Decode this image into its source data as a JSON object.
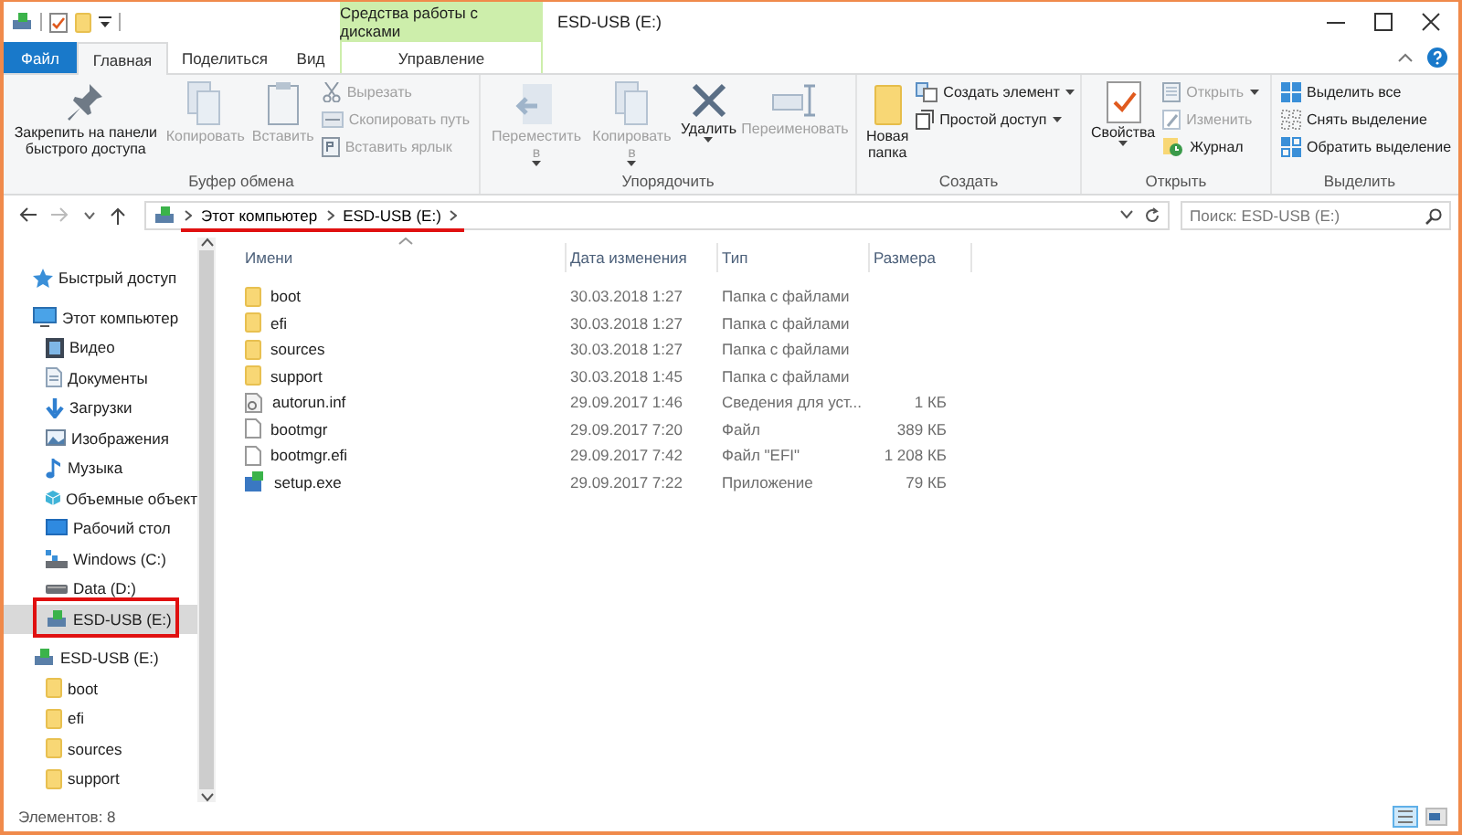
{
  "window": {
    "title": "ESD-USB (E:)",
    "context_tab": "Средства работы с дисками"
  },
  "ribbon_tabs": [
    {
      "label": "Файл",
      "kind": "file",
      "selected": false
    },
    {
      "label": "Главная",
      "kind": "tab",
      "selected": true
    },
    {
      "label": "Поделиться",
      "kind": "tab",
      "selected": false
    },
    {
      "label": "Вид",
      "kind": "tab",
      "selected": false
    },
    {
      "label": "Управление",
      "kind": "context",
      "selected": false
    }
  ],
  "ribbon_groups": [
    {
      "title": "Буфер обмена",
      "items": [
        {
          "label": "Закрепить на панели быстрого доступа",
          "kind": "big",
          "disabled": false,
          "dropdown": false
        },
        {
          "label": "Копировать",
          "kind": "big",
          "disabled": true,
          "dropdown": false
        },
        {
          "label": "Вставить",
          "kind": "big",
          "disabled": true,
          "dropdown": false
        },
        {
          "label": "Вырезать",
          "kind": "small",
          "disabled": true,
          "dropdown": false
        },
        {
          "label": "Скопировать путь",
          "kind": "small",
          "disabled": true,
          "dropdown": false
        },
        {
          "label": "Вставить ярлык",
          "kind": "small",
          "disabled": true,
          "dropdown": false
        }
      ]
    },
    {
      "title": "Упорядочить",
      "items": [
        {
          "label": "Переместить в",
          "kind": "big",
          "disabled": true,
          "dropdown": true
        },
        {
          "label": "Копировать в",
          "kind": "big",
          "disabled": true,
          "dropdown": true
        },
        {
          "label": "Удалить",
          "kind": "big",
          "disabled": false,
          "dropdown": true
        },
        {
          "label": "Переименовать",
          "kind": "big",
          "disabled": true,
          "dropdown": false
        }
      ]
    },
    {
      "title": "Создать",
      "items": [
        {
          "label": "Новая папка",
          "kind": "big",
          "disabled": false,
          "dropdown": false
        },
        {
          "label": "Создать элемент",
          "kind": "small",
          "disabled": false,
          "dropdown": true
        },
        {
          "label": "Простой доступ",
          "kind": "small",
          "disabled": false,
          "dropdown": true
        }
      ]
    },
    {
      "title": "Открыть",
      "items": [
        {
          "label": "Свойства",
          "kind": "big",
          "disabled": false,
          "dropdown": true
        },
        {
          "label": "Открыть",
          "kind": "small",
          "disabled": true,
          "dropdown": true
        },
        {
          "label": "Изменить",
          "kind": "small",
          "disabled": true,
          "dropdown": false
        },
        {
          "label": "Журнал",
          "kind": "small",
          "disabled": false,
          "dropdown": false
        }
      ]
    },
    {
      "title": "Выделить",
      "items": [
        {
          "label": "Выделить все",
          "kind": "small",
          "disabled": false,
          "dropdown": false
        },
        {
          "label": "Снять выделение",
          "kind": "small",
          "disabled": false,
          "dropdown": false
        },
        {
          "label": "Обратить выделение",
          "kind": "small",
          "disabled": false,
          "dropdown": false
        }
      ]
    }
  ],
  "address": {
    "path": [
      "Этот компьютер",
      "ESD-USB (E:)"
    ],
    "underlined": true
  },
  "search": {
    "placeholder": "Поиск: ESD-USB (E:)"
  },
  "nav": [
    {
      "label": "Быстрый доступ",
      "kind": "star",
      "selected": false,
      "highlighted": false
    },
    {
      "label": "Этот компьютер",
      "kind": "pc",
      "selected": false,
      "highlighted": false,
      "children": [
        {
          "label": "Видео",
          "kind": "video",
          "selected": false,
          "highlighted": false
        },
        {
          "label": "Документы",
          "kind": "docs",
          "selected": false,
          "highlighted": false
        },
        {
          "label": "Загрузки",
          "kind": "downloads",
          "selected": false,
          "highlighted": false
        },
        {
          "label": "Изображения",
          "kind": "pictures",
          "selected": false,
          "highlighted": false
        },
        {
          "label": "Музыка",
          "kind": "music",
          "selected": false,
          "highlighted": false
        },
        {
          "label": "Объемные объект",
          "kind": "cube",
          "selected": false,
          "highlighted": false
        },
        {
          "label": "Рабочий стол",
          "kind": "desktop",
          "selected": false,
          "highlighted": false
        },
        {
          "label": "Windows (C:)",
          "kind": "sysdrive",
          "selected": false,
          "highlighted": false
        },
        {
          "label": "Data (D:)",
          "kind": "drive",
          "selected": false,
          "highlighted": false
        },
        {
          "label": "ESD-USB (E:)",
          "kind": "usb",
          "selected": true,
          "highlighted": true
        }
      ]
    },
    {
      "label": "ESD-USB (E:)",
      "kind": "usb",
      "selected": false,
      "highlighted": false,
      "children": [
        {
          "label": "boot",
          "kind": "folder",
          "selected": false,
          "highlighted": false
        },
        {
          "label": "efi",
          "kind": "folder",
          "selected": false,
          "highlighted": false
        },
        {
          "label": "sources",
          "kind": "folder",
          "selected": false,
          "highlighted": false
        },
        {
          "label": "support",
          "kind": "folder",
          "selected": false,
          "highlighted": false
        }
      ]
    }
  ],
  "table": {
    "columns": [
      "Имени",
      "Дата изменения",
      "Тип",
      "Размера"
    ],
    "rows": [
      {
        "kind": "folder",
        "cells": [
          "boot",
          "30.03.2018 1:27",
          "Папка с файлами"
        ]
      },
      {
        "kind": "folder",
        "cells": [
          "efi",
          "30.03.2018 1:27",
          "Папка с файлами"
        ]
      },
      {
        "kind": "folder",
        "cells": [
          "sources",
          "30.03.2018 1:27",
          "Папка с файлами"
        ]
      },
      {
        "kind": "folder",
        "cells": [
          "support",
          "30.03.2018 1:45",
          "Папка с файлами"
        ]
      },
      {
        "kind": "settings",
        "cells": [
          "autorun.inf",
          "29.09.2017 1:46",
          "Сведения для уст...",
          "1 КБ"
        ]
      },
      {
        "kind": "file",
        "cells": [
          "bootmgr",
          "29.09.2017 7:20",
          "Файл",
          "389 КБ"
        ]
      },
      {
        "kind": "file",
        "cells": [
          "bootmgr.efi",
          "29.09.2017 7:42",
          "Файл \"EFI\"",
          "1 208 КБ"
        ]
      },
      {
        "kind": "app",
        "cells": [
          "setup.exe",
          "29.09.2017 7:22",
          "Приложение",
          "79 КБ"
        ]
      }
    ]
  },
  "status_bar": {
    "count": "Элементов: 8"
  }
}
